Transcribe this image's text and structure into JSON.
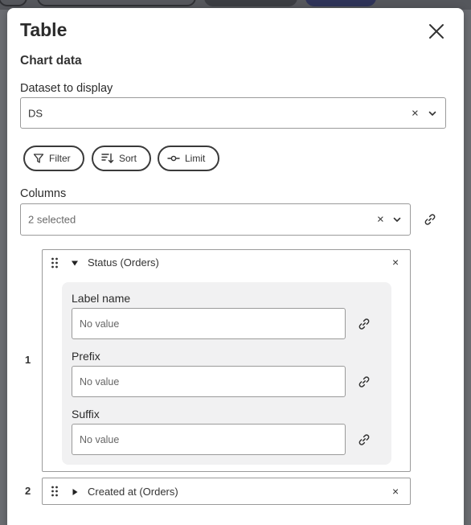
{
  "modal": {
    "title": "Table",
    "section_title": "Chart data"
  },
  "dataset": {
    "label": "Dataset to display",
    "value": "DS",
    "clear_glyph": "×"
  },
  "filters": {
    "filter_label": "Filter",
    "sort_label": "Sort",
    "limit_label": "Limit"
  },
  "columns": {
    "label": "Columns",
    "summary": "2 selected",
    "clear_glyph": "×",
    "items": [
      {
        "index": "1",
        "name": "Status (Orders)",
        "expanded": true,
        "remove_glyph": "×",
        "fields": [
          {
            "label": "Label name",
            "placeholder": "No value"
          },
          {
            "label": "Prefix",
            "placeholder": "No value"
          },
          {
            "label": "Suffix",
            "placeholder": "No value"
          }
        ]
      },
      {
        "index": "2",
        "name": "Created at (Orders)",
        "expanded": false,
        "remove_glyph": "×"
      }
    ]
  },
  "icons": [
    "close-icon",
    "chevron-down-icon",
    "filter-icon",
    "sort-icon",
    "limit-icon",
    "link-icon",
    "drag-handle-icon",
    "caret-down-icon",
    "caret-right-icon"
  ]
}
